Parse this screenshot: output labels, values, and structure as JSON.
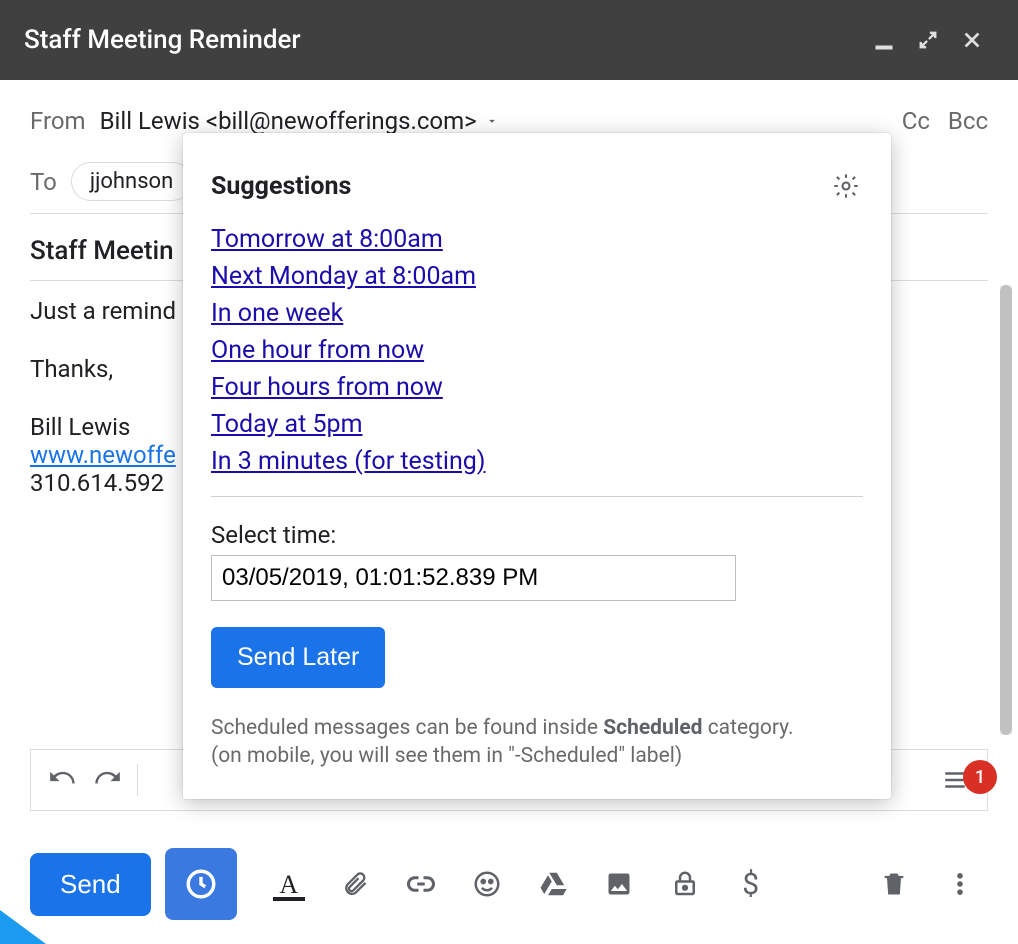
{
  "title": "Staff Meeting Reminder",
  "header": {
    "from_label": "From",
    "from_value": "Bill Lewis <bill@newofferings.com>",
    "cc_label": "Cc",
    "bcc_label": "Bcc",
    "to_label": "To",
    "to_chip": "jjohnson",
    "subject": "Staff Meetin"
  },
  "body": {
    "line1": "Just a remind",
    "thanks": "Thanks,",
    "sig_name": "Bill Lewis",
    "sig_link": "www.newoffe",
    "sig_phone": "310.614.592"
  },
  "popup": {
    "title": "Suggestions",
    "suggestions": [
      "Tomorrow at 8:00am",
      "Next Monday at 8:00am",
      "In one week",
      "One hour from now",
      "Four hours from now",
      "Today at 5pm",
      "In 3 minutes (for testing)"
    ],
    "select_time_label": "Select time:",
    "time_value": "03/05/2019, 01:01:52.839 PM",
    "send_later": "Send Later",
    "note_prefix": "Scheduled messages can be found inside ",
    "note_bold": "Scheduled",
    "note_suffix": " category.",
    "note_line2": "(on mobile, you will see them in \"-Scheduled\" label)"
  },
  "actions": {
    "send": "Send"
  },
  "format_badge": "1"
}
